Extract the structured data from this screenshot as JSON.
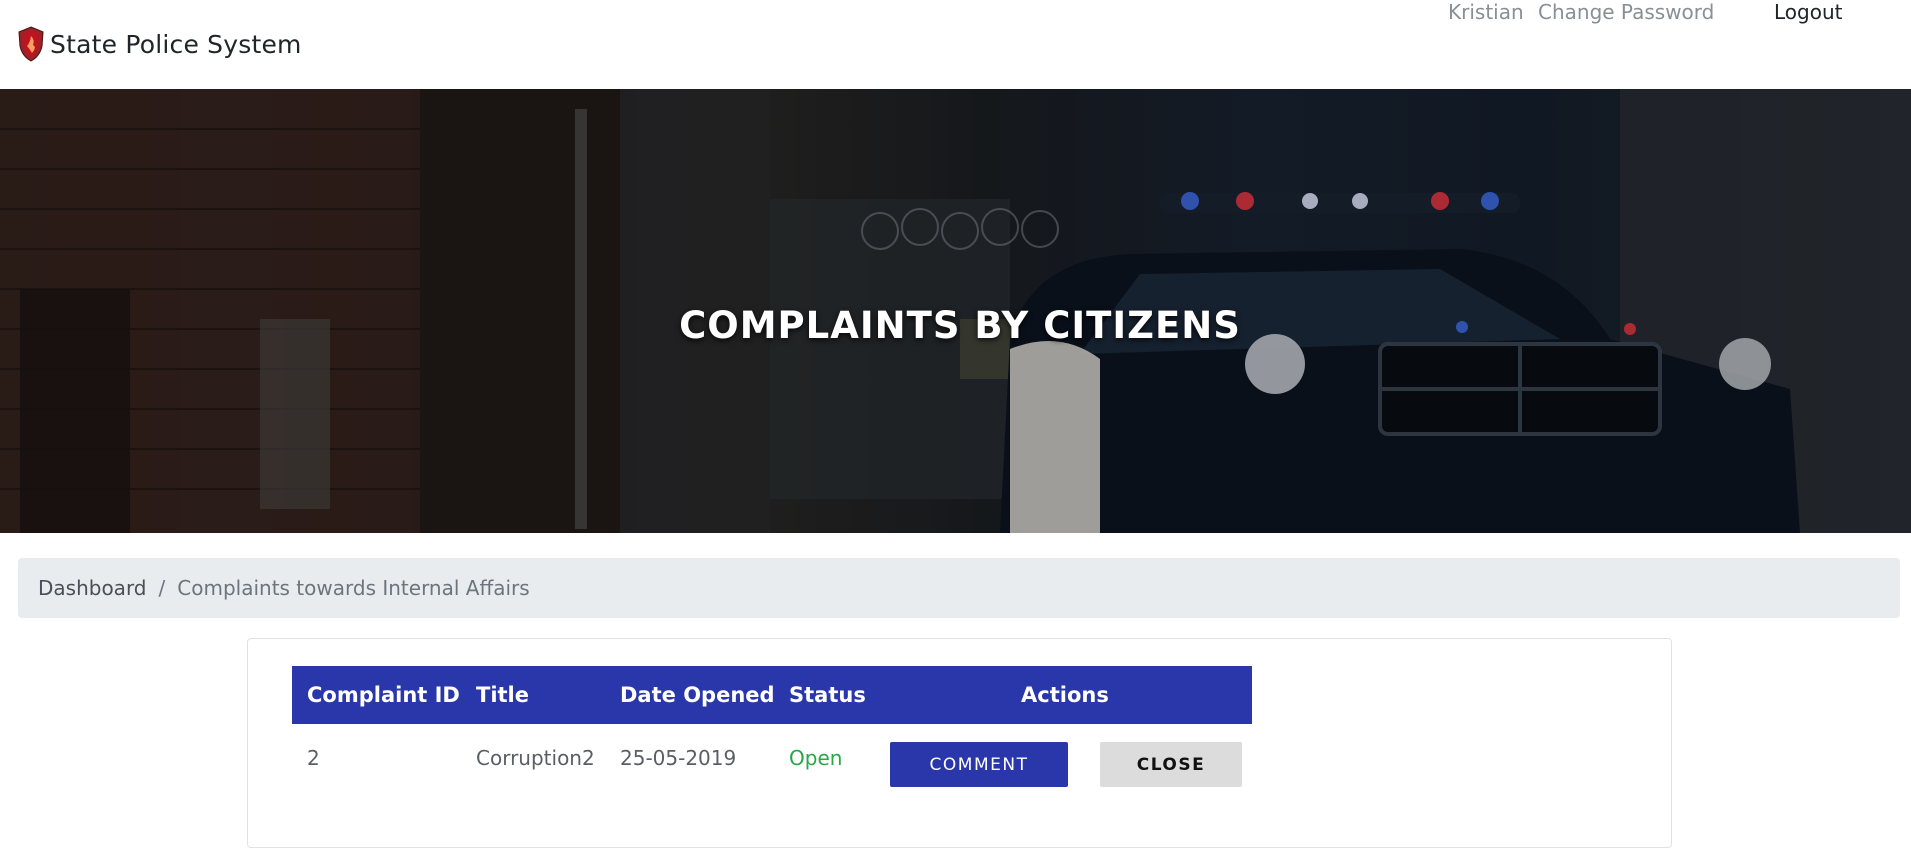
{
  "navbar": {
    "brand": "State Police System",
    "user": "Kristian",
    "change_password": "Change Password",
    "logout": "Logout"
  },
  "hero": {
    "title": "COMPLAINTS BY CITIZENS"
  },
  "breadcrumb": {
    "home": "Dashboard",
    "separator": "/",
    "current": "Complaints towards Internal Affairs"
  },
  "table": {
    "headers": [
      "Complaint ID",
      "Title",
      "Date Opened",
      "Status",
      "Actions"
    ],
    "rows": [
      {
        "id": "2",
        "title": "Corruption2",
        "date": "25-05-2019",
        "status": "Open",
        "comment_label": "COMMENT",
        "close_label": "CLOSE"
      }
    ]
  },
  "colors": {
    "primary": "#2a37aa",
    "status_open": "#28a745",
    "breadcrumb_bg": "#e9ecef"
  }
}
